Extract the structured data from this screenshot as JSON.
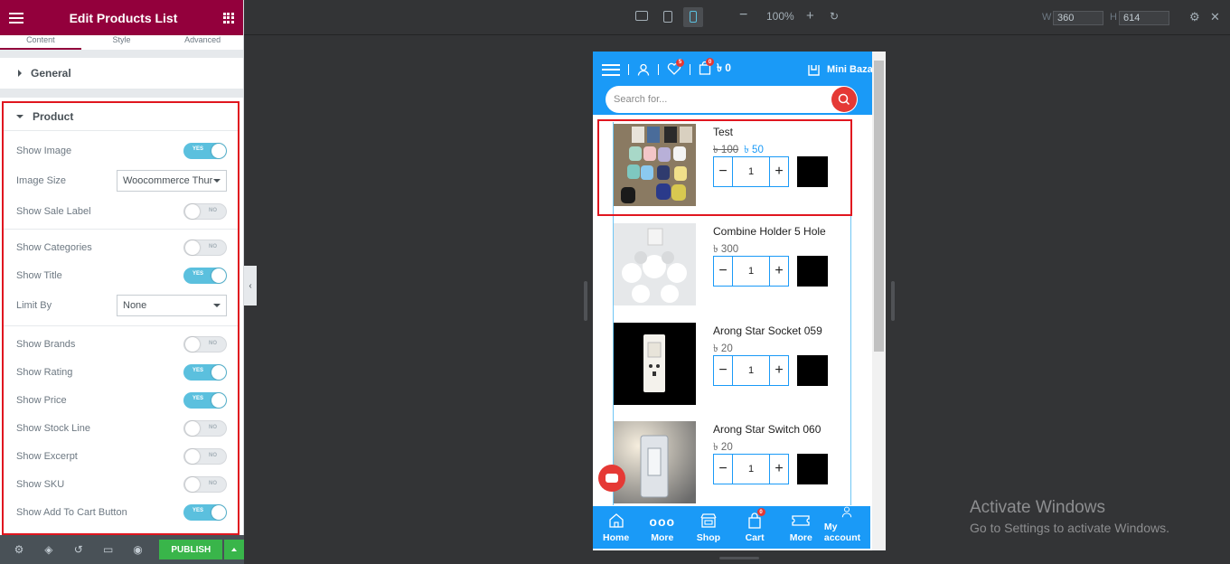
{
  "panel": {
    "title": "Edit Products List",
    "tabs": [
      "Content",
      "Style",
      "Advanced"
    ],
    "general_label": "General",
    "product_label": "Product",
    "controls": {
      "show_image": {
        "label": "Show Image",
        "state": "YES"
      },
      "image_size": {
        "label": "Image Size",
        "value": "Woocommerce Thur"
      },
      "show_sale_label": {
        "label": "Show Sale Label",
        "state": "NO"
      },
      "show_categories": {
        "label": "Show Categories",
        "state": "NO"
      },
      "show_title": {
        "label": "Show Title",
        "state": "YES"
      },
      "limit_by": {
        "label": "Limit By",
        "value": "None"
      },
      "show_brands": {
        "label": "Show Brands",
        "state": "NO"
      },
      "show_rating": {
        "label": "Show Rating",
        "state": "YES"
      },
      "show_price": {
        "label": "Show Price",
        "state": "YES"
      },
      "show_stock_line": {
        "label": "Show Stock Line",
        "state": "NO"
      },
      "show_excerpt": {
        "label": "Show Excerpt",
        "state": "NO"
      },
      "show_sku": {
        "label": "Show SKU",
        "state": "NO"
      },
      "show_add_to_cart": {
        "label": "Show Add To Cart Button",
        "state": "YES"
      }
    },
    "footer": {
      "publish": "PUBLISH"
    }
  },
  "toolbar": {
    "zoom": "100%",
    "width_label": "W",
    "width_value": "360",
    "height_label": "H",
    "height_value": "614"
  },
  "preview": {
    "wishlist_count": "5",
    "cart_count": "0",
    "cart_total": "৳ 0",
    "store_name": "Mini Bazar",
    "search_placeholder": "Search for...",
    "products": [
      {
        "name": "Test",
        "old_price": "৳ 100",
        "price": "৳ 50",
        "qty": "1",
        "image": "earbuds-photo"
      },
      {
        "name": "Combine Holder 5 Hole",
        "price": "৳ 300",
        "qty": "1",
        "image": "bulb-holder-photo"
      },
      {
        "name": "Arong Star Socket 059",
        "price": "৳ 20",
        "qty": "1",
        "image": "socket-photo"
      },
      {
        "name": "Arong Star Switch 060",
        "price": "৳ 20",
        "qty": "1",
        "image": "switch-photo"
      }
    ],
    "bottom_nav": [
      {
        "label": "Home",
        "icon": "home-icon"
      },
      {
        "label": "More",
        "icon": "dots-icon"
      },
      {
        "label": "Shop",
        "icon": "shop-icon"
      },
      {
        "label": "Cart",
        "icon": "cart-icon",
        "badge": "0"
      },
      {
        "label": "More",
        "icon": "ticket-icon"
      },
      {
        "label": "My account",
        "icon": "user-icon"
      }
    ]
  },
  "watermark": {
    "title": "Activate Windows",
    "subtitle": "Go to Settings to activate Windows."
  },
  "colors": {
    "panel_header": "#93003c",
    "accent_blue": "#1a9af7",
    "highlight_red": "#e0161f",
    "publish_green": "#39b54a"
  }
}
